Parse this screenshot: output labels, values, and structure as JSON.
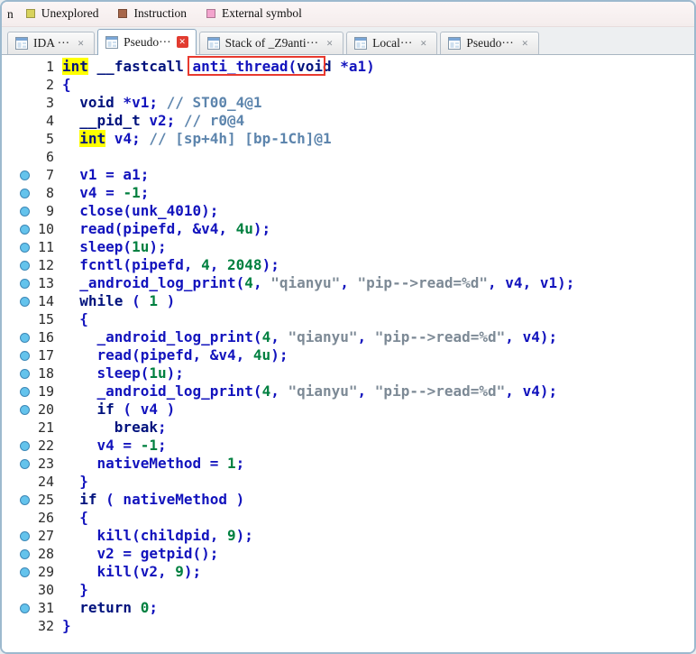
{
  "legend": {
    "cut_text": "n",
    "items": [
      {
        "label": "Unexplored",
        "color": "#d8d25c"
      },
      {
        "label": "Instruction",
        "color": "#a7664a"
      },
      {
        "label": "External symbol",
        "color": "#f3a4cd"
      }
    ]
  },
  "tabs": [
    {
      "id": "ida",
      "label": "IDA ···",
      "active": false
    },
    {
      "id": "pseudocode-1",
      "label": "Pseudo···",
      "active": true
    },
    {
      "id": "stack",
      "label": "Stack of _Z9anti···",
      "active": false
    },
    {
      "id": "local",
      "label": "Local···",
      "active": false
    },
    {
      "id": "pseudocode-2",
      "label": "Pseudo···",
      "active": false
    }
  ],
  "annotation": {
    "box_color": "#e8392e",
    "covers_text": "anti_thread(voi"
  },
  "code": {
    "highlight_color": "#ffff00",
    "breakpoint_color": "#64c3ec",
    "lines": [
      {
        "n": 1,
        "bp": false,
        "t": [
          [
            "h",
            "int"
          ],
          [
            "p",
            " "
          ],
          [
            "k",
            "__fastcall"
          ],
          [
            "p",
            " anti_thread("
          ],
          [
            "k",
            "void"
          ],
          [
            "p",
            " *a1)"
          ]
        ]
      },
      {
        "n": 2,
        "bp": false,
        "t": [
          [
            "p",
            "{"
          ]
        ]
      },
      {
        "n": 3,
        "bp": false,
        "t": [
          [
            "p",
            "  "
          ],
          [
            "k",
            "void"
          ],
          [
            "p",
            " *v1; "
          ],
          [
            "c",
            "// ST00_4@1"
          ]
        ]
      },
      {
        "n": 4,
        "bp": false,
        "t": [
          [
            "p",
            "  "
          ],
          [
            "k",
            "__pid_t"
          ],
          [
            "p",
            " v2; "
          ],
          [
            "c",
            "// r0@4"
          ]
        ]
      },
      {
        "n": 5,
        "bp": false,
        "t": [
          [
            "p",
            "  "
          ],
          [
            "h",
            "int"
          ],
          [
            "p",
            " v4; "
          ],
          [
            "c",
            "// [sp+4h] [bp-1Ch]@1"
          ]
        ]
      },
      {
        "n": 6,
        "bp": false,
        "t": []
      },
      {
        "n": 7,
        "bp": true,
        "t": [
          [
            "p",
            "  v1 = a1;"
          ]
        ]
      },
      {
        "n": 8,
        "bp": true,
        "t": [
          [
            "p",
            "  v4 = "
          ],
          [
            "m",
            "-1"
          ],
          [
            "p",
            ";"
          ]
        ]
      },
      {
        "n": 9,
        "bp": true,
        "t": [
          [
            "p",
            "  close(unk_4010);"
          ]
        ]
      },
      {
        "n": 10,
        "bp": true,
        "t": [
          [
            "p",
            "  read(pipefd, &v4, "
          ],
          [
            "m",
            "4u"
          ],
          [
            "p",
            ");"
          ]
        ]
      },
      {
        "n": 11,
        "bp": true,
        "t": [
          [
            "p",
            "  sleep("
          ],
          [
            "m",
            "1u"
          ],
          [
            "p",
            ");"
          ]
        ]
      },
      {
        "n": 12,
        "bp": true,
        "t": [
          [
            "p",
            "  fcntl(pipefd, "
          ],
          [
            "m",
            "4"
          ],
          [
            "p",
            ", "
          ],
          [
            "m",
            "2048"
          ],
          [
            "p",
            ");"
          ]
        ]
      },
      {
        "n": 13,
        "bp": true,
        "t": [
          [
            "p",
            "  _android_log_print("
          ],
          [
            "m",
            "4"
          ],
          [
            "p",
            ", "
          ],
          [
            "s",
            "\"qianyu\""
          ],
          [
            "p",
            ", "
          ],
          [
            "s",
            "\"pip-->read=%d\""
          ],
          [
            "p",
            ", v4, v1);"
          ]
        ]
      },
      {
        "n": 14,
        "bp": true,
        "t": [
          [
            "p",
            "  "
          ],
          [
            "k",
            "while"
          ],
          [
            "p",
            " ( "
          ],
          [
            "m",
            "1"
          ],
          [
            "p",
            " )"
          ]
        ]
      },
      {
        "n": 15,
        "bp": false,
        "t": [
          [
            "p",
            "  {"
          ]
        ]
      },
      {
        "n": 16,
        "bp": true,
        "t": [
          [
            "p",
            "    _android_log_print("
          ],
          [
            "m",
            "4"
          ],
          [
            "p",
            ", "
          ],
          [
            "s",
            "\"qianyu\""
          ],
          [
            "p",
            ", "
          ],
          [
            "s",
            "\"pip-->read=%d\""
          ],
          [
            "p",
            ", v4);"
          ]
        ]
      },
      {
        "n": 17,
        "bp": true,
        "t": [
          [
            "p",
            "    read(pipefd, &v4, "
          ],
          [
            "m",
            "4u"
          ],
          [
            "p",
            ");"
          ]
        ]
      },
      {
        "n": 18,
        "bp": true,
        "t": [
          [
            "p",
            "    sleep("
          ],
          [
            "m",
            "1u"
          ],
          [
            "p",
            ");"
          ]
        ]
      },
      {
        "n": 19,
        "bp": true,
        "t": [
          [
            "p",
            "    _android_log_print("
          ],
          [
            "m",
            "4"
          ],
          [
            "p",
            ", "
          ],
          [
            "s",
            "\"qianyu\""
          ],
          [
            "p",
            ", "
          ],
          [
            "s",
            "\"pip-->read=%d\""
          ],
          [
            "p",
            ", v4);"
          ]
        ]
      },
      {
        "n": 20,
        "bp": true,
        "t": [
          [
            "p",
            "    "
          ],
          [
            "k",
            "if"
          ],
          [
            "p",
            " ( v4 )"
          ]
        ]
      },
      {
        "n": 21,
        "bp": false,
        "t": [
          [
            "p",
            "      "
          ],
          [
            "k",
            "break"
          ],
          [
            "p",
            ";"
          ]
        ]
      },
      {
        "n": 22,
        "bp": true,
        "t": [
          [
            "p",
            "    v4 = "
          ],
          [
            "m",
            "-1"
          ],
          [
            "p",
            ";"
          ]
        ]
      },
      {
        "n": 23,
        "bp": true,
        "t": [
          [
            "p",
            "    nativeMethod = "
          ],
          [
            "m",
            "1"
          ],
          [
            "p",
            ";"
          ]
        ]
      },
      {
        "n": 24,
        "bp": false,
        "t": [
          [
            "p",
            "  }"
          ]
        ]
      },
      {
        "n": 25,
        "bp": true,
        "t": [
          [
            "p",
            "  "
          ],
          [
            "k",
            "if"
          ],
          [
            "p",
            " ( nativeMethod )"
          ]
        ]
      },
      {
        "n": 26,
        "bp": false,
        "t": [
          [
            "p",
            "  {"
          ]
        ]
      },
      {
        "n": 27,
        "bp": true,
        "t": [
          [
            "p",
            "    kill(childpid, "
          ],
          [
            "m",
            "9"
          ],
          [
            "p",
            ");"
          ]
        ]
      },
      {
        "n": 28,
        "bp": true,
        "t": [
          [
            "p",
            "    v2 = getpid();"
          ]
        ]
      },
      {
        "n": 29,
        "bp": true,
        "t": [
          [
            "p",
            "    kill(v2, "
          ],
          [
            "m",
            "9"
          ],
          [
            "p",
            ");"
          ]
        ]
      },
      {
        "n": 30,
        "bp": false,
        "t": [
          [
            "p",
            "  }"
          ]
        ]
      },
      {
        "n": 31,
        "bp": true,
        "t": [
          [
            "p",
            "  "
          ],
          [
            "k",
            "return"
          ],
          [
            "p",
            " "
          ],
          [
            "m",
            "0"
          ],
          [
            "p",
            ";"
          ]
        ]
      },
      {
        "n": 32,
        "bp": false,
        "t": [
          [
            "p",
            "}"
          ]
        ]
      }
    ]
  }
}
